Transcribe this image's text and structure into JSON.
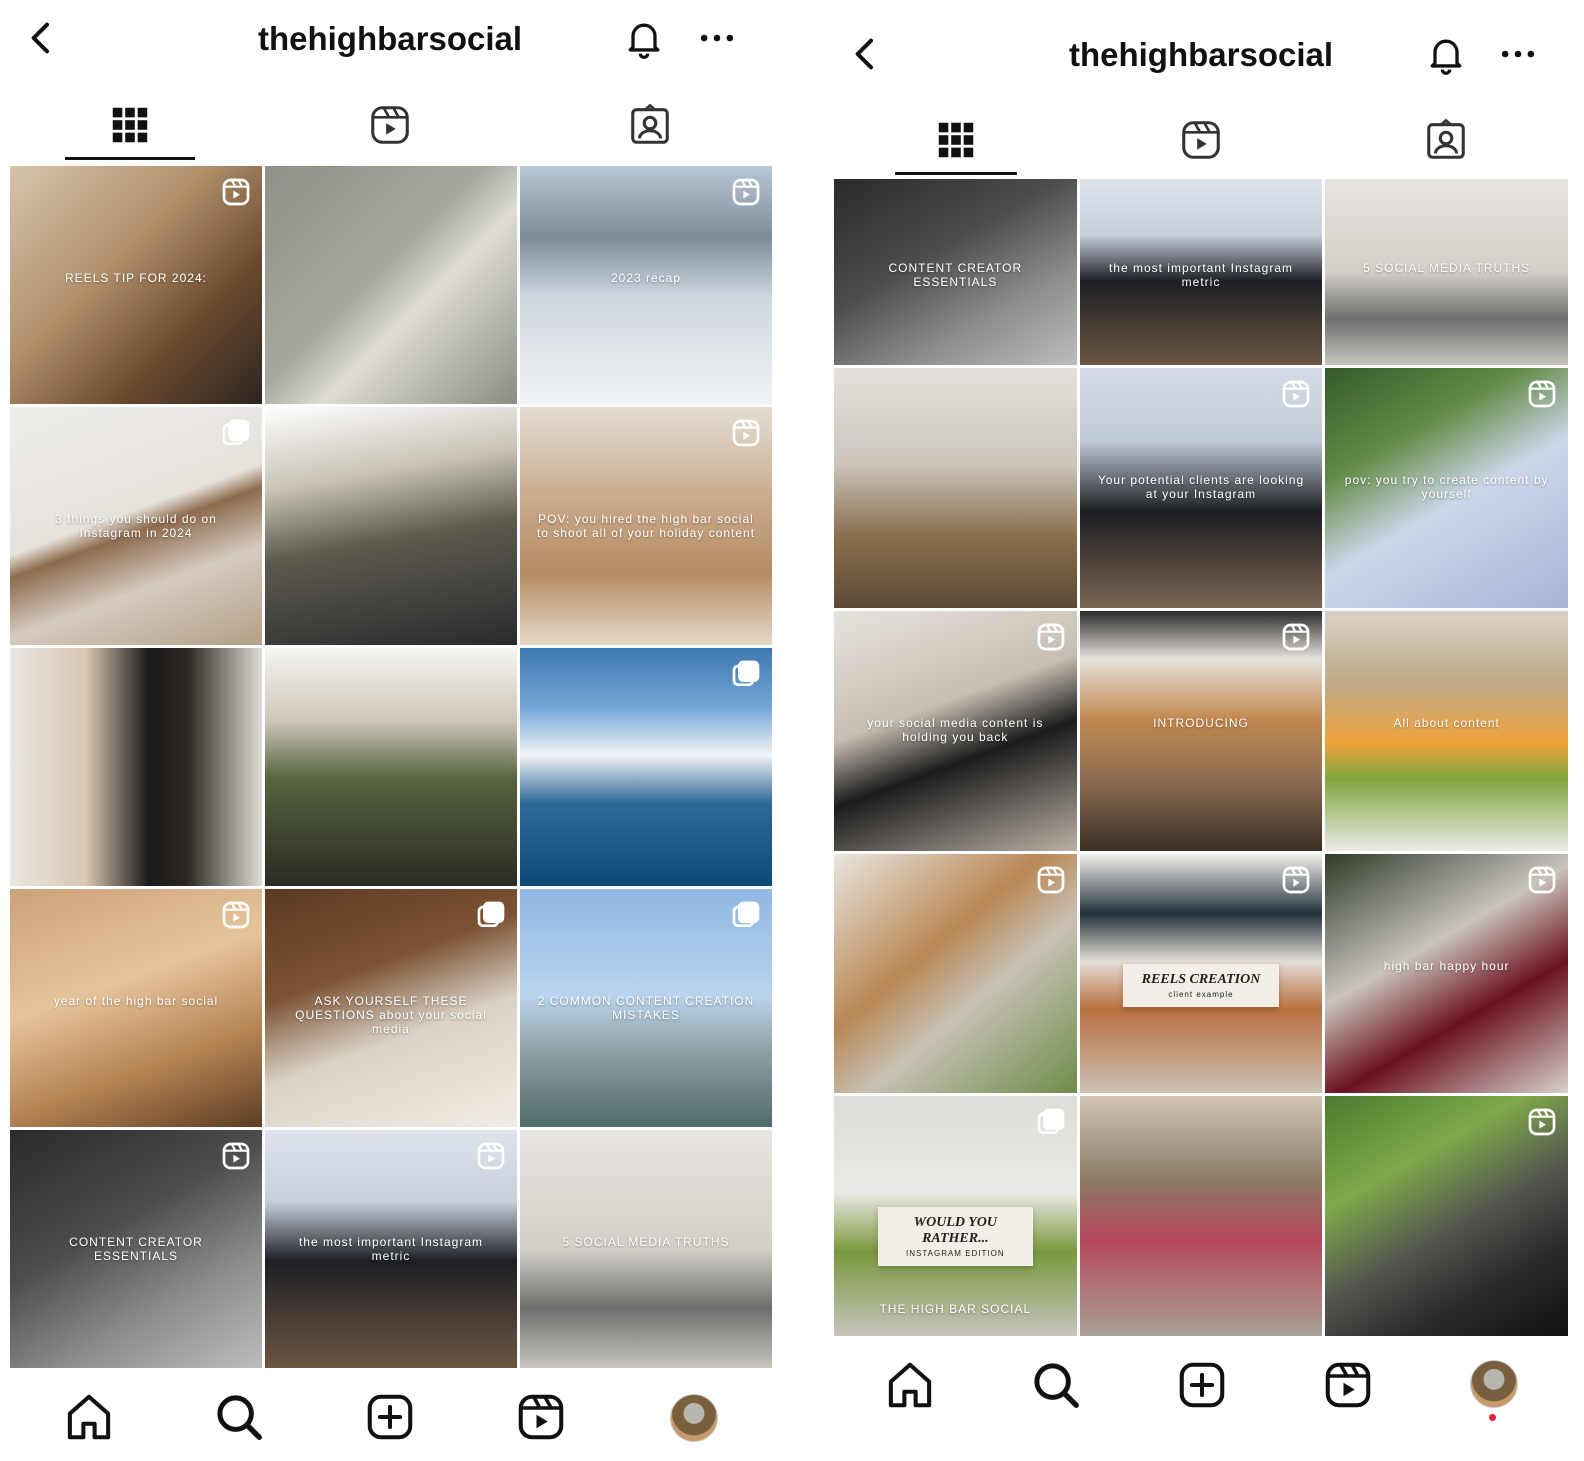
{
  "left": {
    "title": "thehighbarsocial",
    "tiles": [
      {
        "caption": "REELS TIP FOR 2024:",
        "badge": "reel-icon",
        "bg": "linear-gradient(135deg,#d6c4ad 0%,#b2916c 40%,#6b4a2f 70%,#2c2420 100%)"
      },
      {
        "caption": "",
        "badge": "",
        "bg": "linear-gradient(135deg,#8e9187 0%,#a6a89e 45%,#dedcd5 60%,#8a8c82 100%)"
      },
      {
        "caption": "2023 recap",
        "badge": "reel-icon",
        "bg": "linear-gradient(180deg,#b9c6d4 0%,#7d8b9b 30%,#ced6de 55%,#f1f3f5 100%)"
      },
      {
        "caption": "3 things you should do on Instagram in 2024",
        "badge": "carousel-icon",
        "bg": "linear-gradient(160deg,#efeeec 0%,#e6e2dc 45%,#8e6b4e 52%,#d4cbc0 70%,#b59f86 100%)"
      },
      {
        "caption": "",
        "badge": "",
        "bg": "linear-gradient(170deg,#ffffff 0%,#c9c3b7 30%,#5d5a4f 55%,#2a2b2e 100%)"
      },
      {
        "caption": "POV: you hired the high bar social to shoot all of your holiday content",
        "badge": "reel-icon",
        "bg": "linear-gradient(180deg,#e3ddd3 0%,#c9a98a 40%,#b58c64 70%,#e6d9c8 100%)"
      },
      {
        "caption": "",
        "badge": "",
        "bg": "linear-gradient(90deg,#e9e7e2 0%,#d9c7b2 30%,#1a1a1a 55%,#2b2520 70%,#e1ddd6 100%)"
      },
      {
        "caption": "",
        "badge": "",
        "bg": "linear-gradient(180deg,#f6f5f1 0%,#cfc8bb 30%,#56633f 55%,#2c2a24 100%)"
      },
      {
        "caption": "",
        "badge": "carousel-icon",
        "bg": "linear-gradient(180deg,#3f78b4 0%,#74a6d4 25%,#f1f4f7 45%,#2f6a98 65%,#0d4a78 100%)"
      },
      {
        "caption": "year of the high bar social",
        "badge": "reel-icon",
        "bg": "linear-gradient(160deg,#caa27a 0%,#e6c49b 40%,#b58352 70%,#5b3d24 100%)"
      },
      {
        "caption": "ASK YOURSELF THESE QUESTIONS about your social media",
        "badge": "carousel-icon",
        "bg": "linear-gradient(160deg,#5a3a22 0%,#7c5334 35%,#d9d2c6 60%,#f2ede5 100%)"
      },
      {
        "caption": "2 COMMON CONTENT   CREATION MISTAKES",
        "badge": "carousel-icon",
        "bg": "linear-gradient(180deg,#8fb8e3 0%,#b9d3ec 45%,#8a9e9e 70%,#4f6a6c 100%)"
      },
      {
        "caption": "CONTENT CREATOR ESSENTIALS",
        "badge": "reel-icon",
        "bg": "linear-gradient(150deg,#2a2a2a 0%,#4c4c4c 40%,#8d8d8d 70%,#bdbdbd 100%)"
      },
      {
        "caption": "the most important Instagram metric",
        "badge": "reel-icon",
        "bg": "linear-gradient(180deg,#dfe4ec 0%,#c7cfdb 30%,#1d1f24 55%,#6b5642 100%)"
      },
      {
        "caption": "5 SOCIAL MEDIA TRUTHS",
        "badge": "",
        "bg": "linear-gradient(180deg,#e7e5e1 0%,#d3cfc8 50%,#6d6f6d 75%,#c8c5c0 100%)"
      }
    ]
  },
  "right": {
    "title": "thehighbarsocial",
    "tiles": [
      {
        "caption": "CONTENT CREATOR ESSENTIALS",
        "badge": "",
        "bg": "linear-gradient(150deg,#2a2a2a 0%,#4c4c4c 40%,#8d8d8d 70%,#bdbdbd 100%)"
      },
      {
        "caption": "the most important Instagram metric",
        "badge": "",
        "bg": "linear-gradient(180deg,#dfe4ec 0%,#c7cfdb 30%,#1d1f24 55%,#6b5642 100%)"
      },
      {
        "caption": "5 SOCIAL MEDIA TRUTHS",
        "badge": "",
        "bg": "linear-gradient(180deg,#e7e5e1 0%,#d3cfc8 50%,#6d6f6d 75%,#c8c5c0 100%)"
      },
      {
        "caption": "",
        "badge": "",
        "bg": "linear-gradient(180deg,#e4e1dc 0%,#cbc5bc 40%,#8a6e4e 70%,#5d4a36 100%)"
      },
      {
        "caption": "Your potential clients are looking at your Instagram",
        "badge": "reel-icon",
        "bg": "linear-gradient(180deg,#d5dce6 0%,#c0cad6 30%,#1c1e22 60%,#7a6552 100%)"
      },
      {
        "caption": "pov: you try to create content by yourself",
        "badge": "reel-icon",
        "bg": "linear-gradient(150deg,#355a2a 0%,#628b46 30%,#cdd6ea 55%,#a6b4d6 100%)"
      },
      {
        "caption": "your social media content is holding you back",
        "badge": "reel-icon",
        "bg": "linear-gradient(160deg,#e7e3dd 0%,#c6beb3 40%,#1b1b1b 60%,#bab1a6 100%)"
      },
      {
        "caption": "INTRODUCING",
        "badge": "reel-icon",
        "bg": "linear-gradient(180deg,#2a2a2a 0%,#e6e2dc 20%,#c1884e 45%,#8d6d52 70%,#3d2f26 100%)"
      },
      {
        "caption": "All about content",
        "badge": "",
        "bg": "linear-gradient(180deg,#d9d2c8 0%,#bfa987 30%,#f0a23c 55%,#7fa63c 70%,#ecebe7 100%)"
      },
      {
        "caption": "",
        "badge": "reel-icon",
        "bg": "linear-gradient(140deg,#e9e6e0 0%,#b98855 40%,#c7c1b5 60%,#6f8c4a 100%)"
      },
      {
        "caption": "",
        "badge": "reel-icon",
        "card": "REELS CREATION",
        "card_sub": "client example",
        "bg": "linear-gradient(180deg,#f3f1ec 0%,#23313c 25%,#e3ded6 45%,#b86f3f 65%,#cbc2b5 100%)"
      },
      {
        "caption": "high bar happy hour",
        "badge": "reel-icon",
        "bg": "linear-gradient(150deg,#2e3a2a 0%,#c9c4bc 40%,#6b1020 65%,#d6d2cc 100%)"
      },
      {
        "caption": "THE HIGH BAR SOCIAL",
        "badge": "carousel-icon",
        "card": "WOULD YOU RATHER...",
        "card_sub": "INSTAGRAM EDITION",
        "bg": "linear-gradient(180deg,#dedcd8 0%,#eceae6 40%,#79983d 65%,#c7c4bd 100%)"
      },
      {
        "caption": "",
        "badge": "",
        "bg": "linear-gradient(180deg,#d2c5b4 0%,#8c7a66 35%,#b5485a 60%,#a9a096 100%)"
      },
      {
        "caption": "",
        "badge": "reel-icon",
        "bg": "linear-gradient(150deg,#4c7a2e 0%,#7ea94a 30%,#53534f 55%,#2b2b2b 75%,#101010 100%)"
      }
    ]
  },
  "icons": {
    "back": "chevron-left-icon",
    "bell": "bell-icon",
    "more": "more-icon",
    "grid_tab": "grid-icon",
    "reels_tab": "reels-icon",
    "tagged_tab": "tagged-icon",
    "home": "home-icon",
    "search": "search-icon",
    "add": "add-icon",
    "reels": "reels-icon"
  },
  "colors": {
    "text": "#111111",
    "notification": "#ed1e3a"
  }
}
